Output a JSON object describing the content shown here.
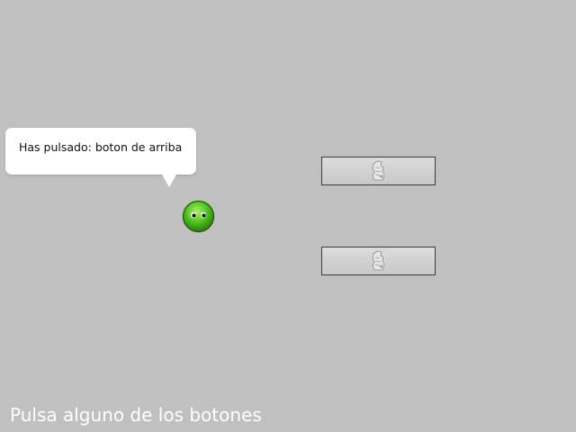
{
  "speech_bubble": {
    "text": "Has pulsado: boton de arriba"
  },
  "character": {
    "icon": "green-blob-icon",
    "color": "#4cc21a"
  },
  "buttons": [
    {
      "id": "top",
      "icon": "broken-image-icon"
    },
    {
      "id": "bottom",
      "icon": "broken-image-icon"
    }
  ],
  "footer": {
    "instruction": "Pulsa alguno de los botones"
  },
  "colors": {
    "background": "#c0c0c0",
    "bubble": "#ffffff",
    "footer_text": "#ffffff"
  }
}
